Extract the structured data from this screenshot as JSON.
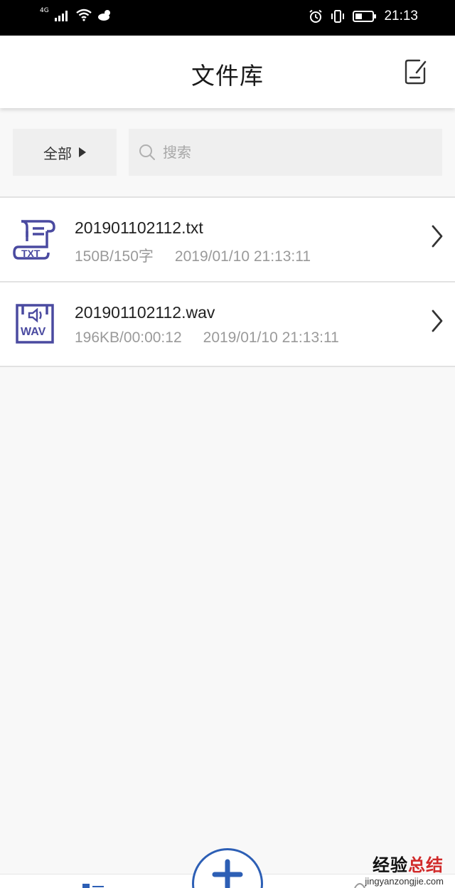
{
  "status_bar": {
    "network": "4G",
    "time": "21:13"
  },
  "header": {
    "title": "文件库",
    "action_icon": "edit-note-icon"
  },
  "filter": {
    "label": "全部",
    "icon": "triangle-right-icon"
  },
  "search": {
    "placeholder": "搜索",
    "value": "",
    "icon": "search-icon"
  },
  "files": [
    {
      "name": "201901102112.txt",
      "size": "150B/150字",
      "date": "2019/01/10 21:13:11",
      "icon": "txt-file-icon",
      "icon_label": "TXT"
    },
    {
      "name": "201901102112.wav",
      "size": "196KB/00:00:12",
      "date": "2019/01/10 21:13:11",
      "icon": "wav-file-icon",
      "icon_label": "WAV"
    }
  ],
  "fab": {
    "icon": "plus-icon"
  },
  "watermark": {
    "main_black": "经验",
    "main_red": "总结",
    "sub": "jingyanzongjie.com"
  },
  "colors": {
    "accent": "#2d5fb5",
    "icon_purple": "#4a4aa0",
    "text_secondary": "#9a9a9a",
    "watermark_red": "#d12a2a"
  }
}
